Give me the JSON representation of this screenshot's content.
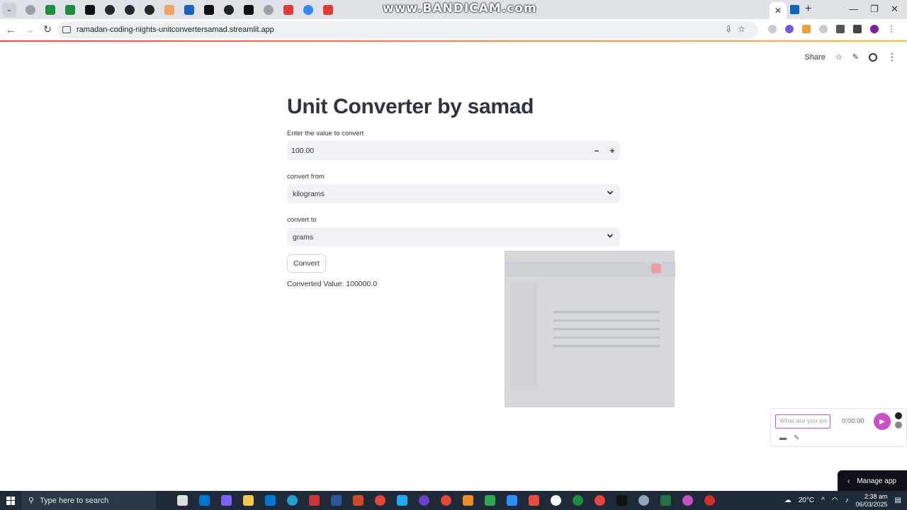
{
  "browser": {
    "overlay_watermark": "www.BANDICAM.com",
    "url": "ramadan-coding-nights-unitconvertersamad.streamlit.app"
  },
  "header": {
    "share_label": "Share"
  },
  "main": {
    "title": "Unit Converter by samad",
    "value_input": {
      "label": "Enter the value to convert",
      "value": "100.00"
    },
    "from_select": {
      "label": "convert from",
      "selected": "kilograms"
    },
    "to_select": {
      "label": "convert to",
      "selected": "grams"
    },
    "convert_button": "Convert",
    "result_text": "Converted Value: 100000.0"
  },
  "recorder": {
    "placeholder": "What are you wo",
    "time": "0:00:00"
  },
  "manage_app_label": "Manage app",
  "taskbar": {
    "search_placeholder": "Type here to search",
    "temperature": "20°C",
    "time": "2:38 am",
    "date": "06/03/2025"
  },
  "colors": {
    "accent": "#ff4b4b",
    "field_bg": "#f0f2f6",
    "text": "#31333f",
    "recorder_accent": "#c94fc3"
  }
}
